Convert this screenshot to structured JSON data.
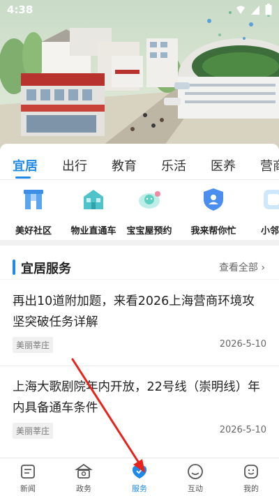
{
  "status_bar": {
    "time": "4:38"
  },
  "colors": {
    "accent": "#1e8ae6",
    "annotation_arrow": "#e8231c"
  },
  "tabs": [
    {
      "label": "宜居",
      "active": true
    },
    {
      "label": "出行"
    },
    {
      "label": "教育"
    },
    {
      "label": "乐活"
    },
    {
      "label": "医养"
    },
    {
      "label": "营商"
    }
  ],
  "quick_access": [
    {
      "label": "美好社区",
      "icon": "community-gate-icon"
    },
    {
      "label": "物业直通车",
      "icon": "property-building-icon"
    },
    {
      "label": "宝宝屋预约",
      "icon": "baby-house-icon"
    },
    {
      "label": "我来帮你忙",
      "icon": "volunteer-shield-icon"
    },
    {
      "label": "小邻",
      "icon": "neighbor-icon"
    }
  ],
  "section": {
    "title": "宜居服务",
    "view_all": "查看全部"
  },
  "news": [
    {
      "title": "再出10道附加题，来看2026上海营商环境攻坚突破任务详解",
      "tag": "美丽莘庄",
      "date": "2026-5-10"
    },
    {
      "title": "上海大歌剧院年内开放，22号线（崇明线）年内具备通车条件",
      "tag": "美丽莘庄",
      "date": "2026-5-10"
    }
  ],
  "bottom_nav": [
    {
      "label": "新闻",
      "icon": "news-icon"
    },
    {
      "label": "政务",
      "icon": "government-icon"
    },
    {
      "label": "服务",
      "icon": "service-icon",
      "active": true
    },
    {
      "label": "互动",
      "icon": "chat-icon"
    },
    {
      "label": "我的",
      "icon": "profile-icon"
    }
  ]
}
